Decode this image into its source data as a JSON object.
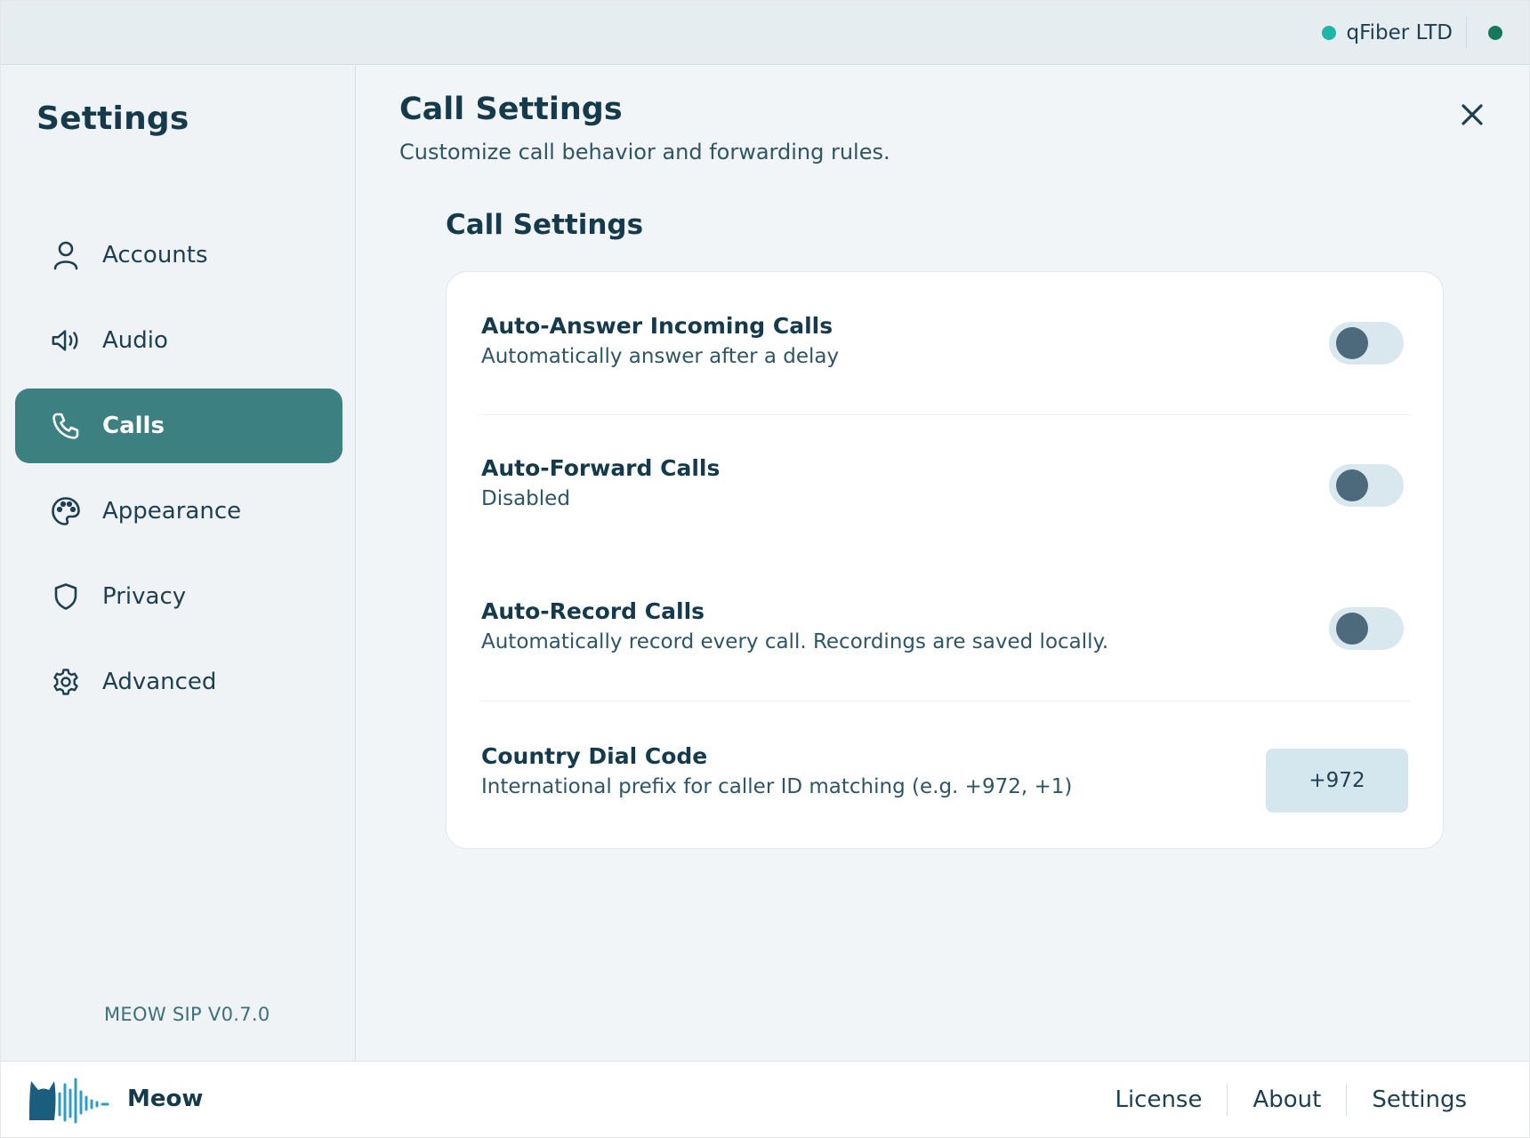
{
  "colors": {
    "accent": "#3d8081",
    "account_dot": "#1fb5a9",
    "status_dot": "#157a5c",
    "toggle_track": "#d9e8ee",
    "toggle_knob": "#4d6a7d"
  },
  "topbar": {
    "account_name": "qFiber LTD"
  },
  "sidebar": {
    "title": "Settings",
    "items": [
      {
        "label": "Accounts",
        "icon": "user-icon"
      },
      {
        "label": "Audio",
        "icon": "speaker-icon"
      },
      {
        "label": "Calls",
        "icon": "phone-icon",
        "active": true
      },
      {
        "label": "Appearance",
        "icon": "palette-icon"
      },
      {
        "label": "Privacy",
        "icon": "shield-icon"
      },
      {
        "label": "Advanced",
        "icon": "gear-icon"
      }
    ],
    "version": "MEOW SIP V0.7.0"
  },
  "main": {
    "title": "Call Settings",
    "subtitle": "Customize call behavior and forwarding rules.",
    "section_title": "Call Settings",
    "settings": [
      {
        "title": "Auto-Answer Incoming Calls",
        "description": "Automatically answer after a delay",
        "enabled": false
      },
      {
        "title": "Auto-Forward Calls",
        "description": "Disabled",
        "enabled": false
      },
      {
        "title": "Auto-Record Calls",
        "description": "Automatically record every call. Recordings are saved locally.",
        "enabled": false
      },
      {
        "title": "Country Dial Code",
        "description": "International prefix for caller ID matching (e.g. +972, +1)",
        "value": "+972"
      }
    ]
  },
  "footer": {
    "brand": "Meow",
    "links": [
      "License",
      "About",
      "Settings"
    ]
  }
}
